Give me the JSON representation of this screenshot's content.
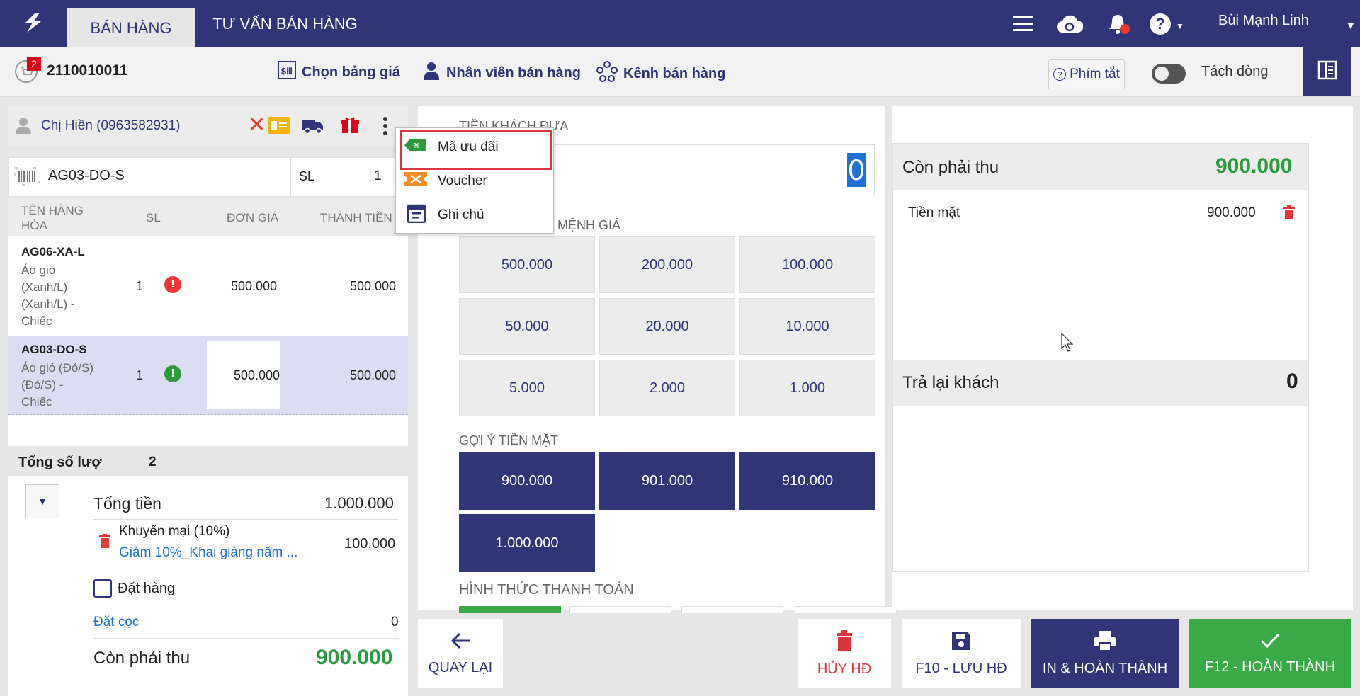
{
  "topbar": {
    "tabs": [
      "BÁN HÀNG",
      "TƯ VẤN BÁN HÀNG"
    ],
    "user_name": "Bùi Mạnh Linh",
    "notification_count": "2"
  },
  "subbar": {
    "invoice_code": "2110010011",
    "price_list_label": "Chọn bảng giá",
    "staff_label": "Nhân viên bán hàng",
    "channel_label": "Kênh bán hàng",
    "shortcut_label": "Phím tắt",
    "split_label": "Tách dòng",
    "split_enabled": false
  },
  "customer": {
    "name": "Chị Hiền (0963582931)"
  },
  "barcode": {
    "product_code": "AG03-DO-S",
    "qty_label": "SL",
    "qty_value": "1"
  },
  "table": {
    "headers": [
      "TÊN HÀNG HÓA",
      "SL",
      "ĐƠN GIÁ",
      "THÀNH TIỀN"
    ],
    "rows": [
      {
        "code": "AG06-XA-L",
        "desc": [
          "Áo gió",
          "(Xanh/L)",
          "(Xanh/L) -",
          "Chiếc"
        ],
        "qty": "1",
        "price": "500.000",
        "total": "500.000",
        "status": "!"
      },
      {
        "code": "AG03-DO-S",
        "desc": [
          "Áo gió (Đỏ/S)",
          "(Đỏ/S) -",
          "Chiếc"
        ],
        "qty": "1",
        "price": "500.000",
        "total": "500.000",
        "status": "!"
      }
    ]
  },
  "summary": {
    "total_qty_label": "Tổng số lượ",
    "total_qty": "2",
    "total_label": "Tổng tiền",
    "total_value": "1.000.000",
    "promo_label": "Khuyến mại (10%)",
    "promo_link": "Giảm 10%_Khai giảng năm ...",
    "promo_value": "100.000",
    "order_label": "Đặt hàng",
    "deposit_label": "Đặt cọc",
    "deposit_value": "0",
    "remaining_label": "Còn phải thu",
    "remaining_value": "900.000"
  },
  "menu": {
    "items": [
      "Mã ưu đãi",
      "Voucher",
      "Ghi chú"
    ]
  },
  "payment": {
    "cash_given_label": "TIỀN KHÁCH ĐƯA",
    "cash_given_value": "0",
    "denom_label": "EO MỆNH GIÁ",
    "denominations": [
      "500.000",
      "200.000",
      "100.000",
      "50.000",
      "20.000",
      "10.000",
      "5.000",
      "2.000",
      "1.000"
    ],
    "suggest_label": "GỢI Ý TIỀN MẶT",
    "suggestions": [
      "900.000",
      "901.000",
      "910.000",
      "1.000.000"
    ],
    "method_label": "HÌNH THỨC THANH TOÁN"
  },
  "right": {
    "remaining_label": "Còn phải thu",
    "remaining_value": "900.000",
    "cash_label": "Tiền mặt",
    "cash_value": "900.000",
    "change_label": "Trả lại khách",
    "change_value": "0"
  },
  "actions": {
    "back": "QUAY LẠI",
    "cancel": "HỦY HĐ",
    "save": "F10 - LƯU HĐ",
    "print": "IN & HOÀN THÀNH",
    "finish": "F12 - HOÀN THÀNH"
  },
  "colors": {
    "brand": "#2f3577",
    "success": "#3aaa48",
    "danger": "#d9363e",
    "accent_blue": "#1e73d2"
  }
}
